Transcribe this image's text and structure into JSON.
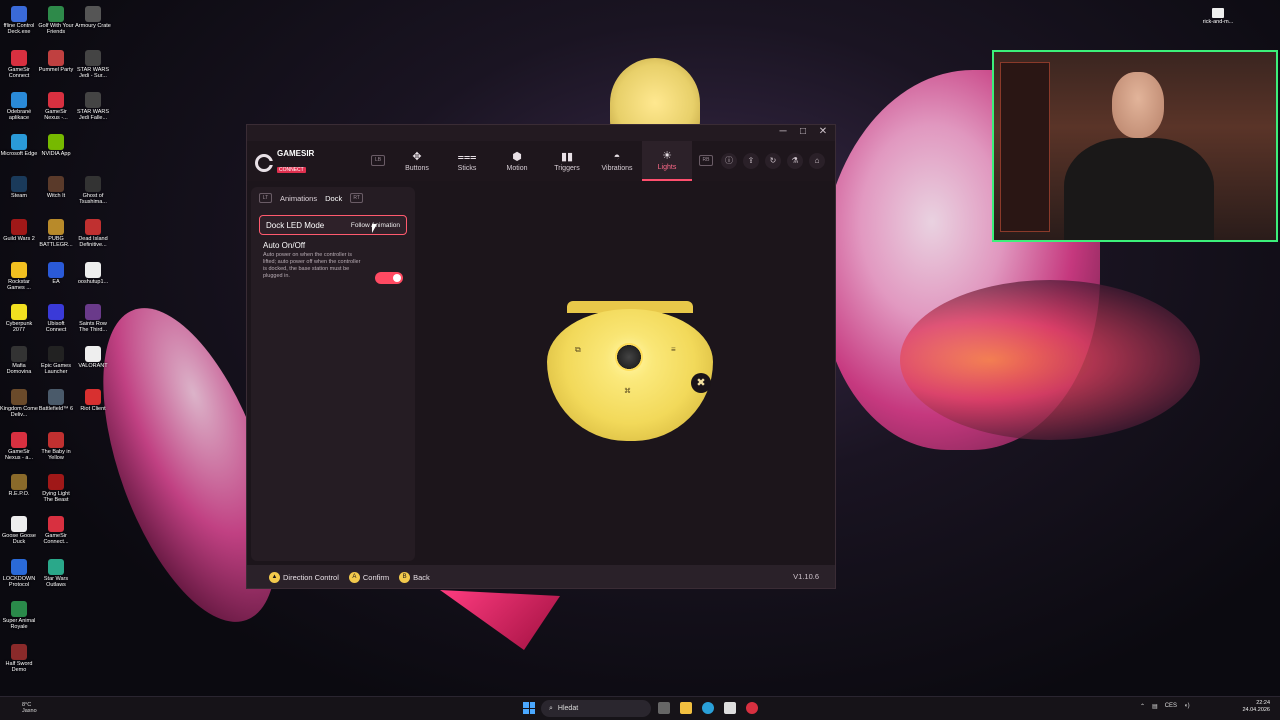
{
  "desktop": {
    "icons": [
      {
        "label": "ffline Control Deck.exe",
        "color": "#3a6ad8"
      },
      {
        "label": "Golf With Your Friends",
        "color": "#2e8a4a"
      },
      {
        "label": "Armoury Crate",
        "color": "#555"
      },
      {
        "label": "GameSir Connect",
        "color": "#d83040"
      },
      {
        "label": "Pummel Party",
        "color": "#c04040"
      },
      {
        "label": "STAR WARS Jedi - Sur...",
        "color": "#444"
      },
      {
        "label": "Odebrané aplikace",
        "color": "#2a8ad8"
      },
      {
        "label": "GameSir Nexus -...",
        "color": "#d83040"
      },
      {
        "label": "STAR WARS Jedi Falle...",
        "color": "#444"
      },
      {
        "label": "Microsoft Edge",
        "color": "#2a9ad8"
      },
      {
        "label": "NVIDIA App",
        "color": "#76b900"
      },
      {
        "label": "Steam",
        "color": "#1a3a5a"
      },
      {
        "label": "Witch It",
        "color": "#5a3a2a"
      },
      {
        "label": "Ghost of Tsushima...",
        "color": "#333"
      },
      {
        "label": "Guild Wars 2",
        "color": "#a01818"
      },
      {
        "label": "PUBG BATTLEGR...",
        "color": "#b88a2a"
      },
      {
        "label": "Dead Island Definitive...",
        "color": "#c03030"
      },
      {
        "label": "Rockstar Games ...",
        "color": "#f2c020"
      },
      {
        "label": "EA",
        "color": "#2a5ad8"
      },
      {
        "label": "ooshutup1...",
        "color": "#eee"
      },
      {
        "label": "Cyberpunk 2077",
        "color": "#f2e020"
      },
      {
        "label": "Ubisoft Connect",
        "color": "#3a3ad8"
      },
      {
        "label": "Saints Row The Third...",
        "color": "#6a3a8a"
      },
      {
        "label": "Mafia Domovina",
        "color": "#333"
      },
      {
        "label": "Epic Games Launcher",
        "color": "#222"
      },
      {
        "label": "VALORANT",
        "color": "#eee"
      },
      {
        "label": "Kingdom Come Deliv...",
        "color": "#6a4a2a"
      },
      {
        "label": "Battlefield™ 6",
        "color": "#4a5a6a"
      },
      {
        "label": "Riot Client",
        "color": "#d83030"
      },
      {
        "label": "GameSir Nexus - a...",
        "color": "#d83040"
      },
      {
        "label": "The Baby in Yellow",
        "color": "#c03030"
      },
      {
        "label": "R.E.P.O.",
        "color": "#8a6a2a"
      },
      {
        "label": "Dying Light The Beast",
        "color": "#a01818"
      },
      {
        "label": "Goose Goose Duck",
        "color": "#eee"
      },
      {
        "label": "GameSir Connect...",
        "color": "#d83040"
      },
      {
        "label": "LOCKDOWN Protocol",
        "color": "#2a6ad8"
      },
      {
        "label": "Star Wars Outlaws",
        "color": "#2aa88a"
      },
      {
        "label": "Super Animal Royale",
        "color": "#2a8a4a"
      },
      {
        "label": "Half Sword Demo",
        "color": "#8a2a2a"
      }
    ],
    "tray_top_label": "rick-and-m..."
  },
  "window": {
    "controls": {
      "minimize": "─",
      "maximize": "□",
      "close": "✕"
    },
    "logo": {
      "name": "GAMESIR",
      "sub": "CONNECT"
    },
    "nav_bumper_left": "LB",
    "nav_bumper_right": "RB",
    "nav": [
      {
        "label": "Buttons",
        "icon": "✥"
      },
      {
        "label": "Sticks",
        "icon": "⩶"
      },
      {
        "label": "Motion",
        "icon": "⬢"
      },
      {
        "label": "Triggers",
        "icon": "▮▮"
      },
      {
        "label": "Vibrations",
        "icon": "◓"
      },
      {
        "label": "Lights",
        "icon": "☀"
      }
    ],
    "tools": [
      "ⓘ",
      "⇪",
      "↻",
      "⚗",
      "⌂"
    ]
  },
  "panel": {
    "bumper_left": "LT",
    "bumper_right": "RT",
    "tabs": [
      "Animations",
      "Dock"
    ],
    "led_mode_label": "Dock LED Mode",
    "led_mode_value": "Follow Animation",
    "auto_title": "Auto On/Off",
    "auto_desc": "Auto power on when the controller is lifted; auto power off when the controller is docked, the base station must be plugged in.",
    "auto_enabled": true
  },
  "controller": {
    "btn_share": "⧉",
    "btn_menu": "≡",
    "btn_bottom": "⌘",
    "btn_x": "✖"
  },
  "bottombar": {
    "hints": [
      {
        "icon": "▲",
        "label": "Direction Control"
      },
      {
        "icon": "A",
        "label": "Confirm"
      },
      {
        "icon": "B",
        "label": "Back"
      }
    ],
    "version": "V1.10.6"
  },
  "taskbar": {
    "weather_temp": "8°C",
    "weather_text": "Jasno",
    "search_placeholder": "Hledat",
    "tray_lang": "CES",
    "clock_time": "22:24",
    "clock_date": "24.04.2026"
  },
  "colors": {
    "accent": "#ff4f6e",
    "webcam_border": "#3cf07a"
  }
}
